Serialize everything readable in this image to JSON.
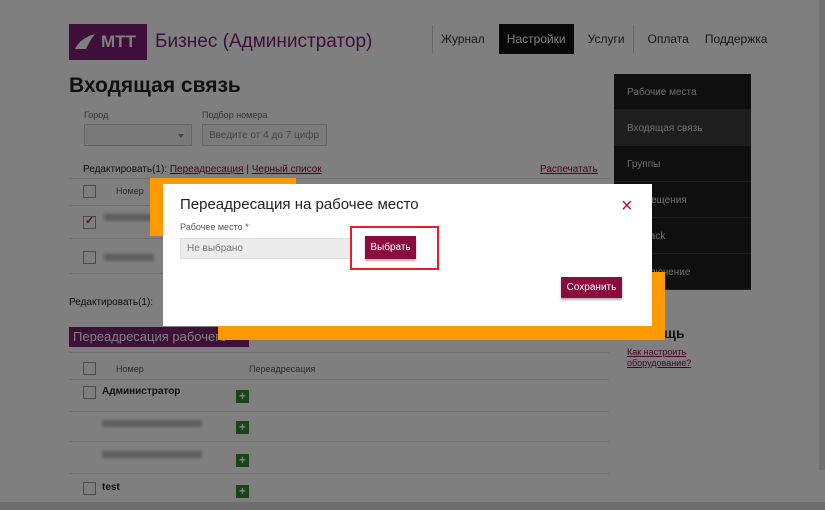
{
  "header": {
    "logo_text": "МТТ",
    "logo_subtitle": "Бизнес (Администратор)",
    "nav": [
      "Журнал",
      "Настройки",
      "Услуги",
      "Оплата",
      "Поддержка"
    ],
    "active_nav": "Настройки"
  },
  "page": {
    "title": "Входящая связь",
    "city_label": "Город",
    "number_label": "Подбор номера",
    "number_placeholder": "Введите от 4 до 7 цифр",
    "edit_prefix": "Редактировать(1):",
    "edit_forward": "Переадресация",
    "edit_sep": "|",
    "edit_black": "Черный список",
    "print_link": "Распечатать",
    "col_number": "Номер",
    "edit_prefix2": "Редактировать(1):"
  },
  "section": {
    "title": "Переадресация рабочего места",
    "col_number": "Номер",
    "col_forward": "Переадресация",
    "rows": [
      "Администратор",
      "",
      "",
      "test"
    ]
  },
  "sidebar": {
    "items": [
      "Рабочие места",
      "Входящая связь",
      "Группы",
      "Оповещения",
      "Callback",
      "Подключение"
    ],
    "active": 1
  },
  "help": {
    "title": "Помощь",
    "link": "Как настроить оборудование?"
  },
  "modal": {
    "title": "Переадресация на рабочее место",
    "field_label": "Рабочее место",
    "required_mark": "*",
    "field_value": "Не выбрано",
    "choose_button": "Выбрать",
    "save_button": "Сохранить",
    "close_icon": "×"
  },
  "colors": {
    "brand": "#7a1e73",
    "accent": "#8a0c3e",
    "highlight": "#e81c2c",
    "orange": "#ff9900"
  }
}
